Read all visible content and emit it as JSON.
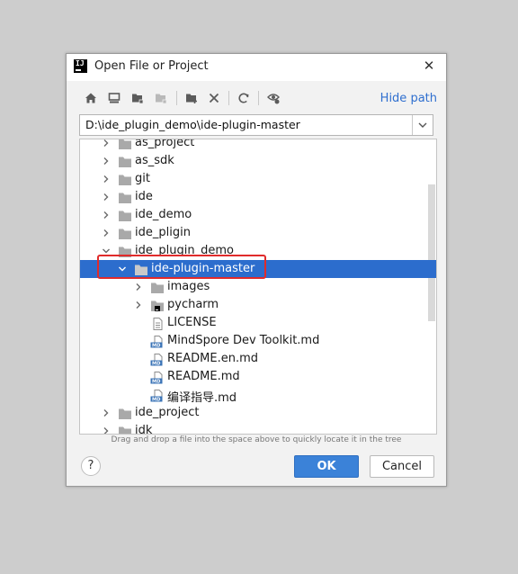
{
  "dialog": {
    "title": "Open File or Project",
    "hide_path_label": "Hide path",
    "path_value": "D:\\ide_plugin_demo\\ide-plugin-master",
    "hint": "Drag and drop a file into the space above to quickly locate it in the tree",
    "ok_label": "OK",
    "cancel_label": "Cancel",
    "help_label": "?"
  },
  "toolbar": {
    "buttons": [
      "home-icon",
      "desktop-icon",
      "project-folder-icon",
      "module-folder-icon",
      "new-folder-icon",
      "delete-icon",
      "refresh-icon",
      "show-hidden-icon"
    ]
  },
  "tree": {
    "rows": [
      {
        "label": "as_project",
        "level": 0,
        "expanded": false,
        "kind": "folder"
      },
      {
        "label": "as_sdk",
        "level": 0,
        "expanded": false,
        "kind": "folder"
      },
      {
        "label": "git",
        "level": 0,
        "expanded": false,
        "kind": "folder"
      },
      {
        "label": "ide",
        "level": 0,
        "expanded": false,
        "kind": "folder"
      },
      {
        "label": "ide_demo",
        "level": 0,
        "expanded": false,
        "kind": "folder"
      },
      {
        "label": "ide_pligin",
        "level": 0,
        "expanded": false,
        "kind": "folder"
      },
      {
        "label": "ide_plugin_demo",
        "level": 0,
        "expanded": true,
        "kind": "folder"
      },
      {
        "label": "ide-plugin-master",
        "level": 1,
        "expanded": true,
        "kind": "folder",
        "selected": true
      },
      {
        "label": "images",
        "level": 2,
        "expanded": false,
        "kind": "folder"
      },
      {
        "label": "pycharm",
        "level": 2,
        "expanded": false,
        "kind": "pycharm-folder"
      },
      {
        "label": "LICENSE",
        "level": 2,
        "kind": "file"
      },
      {
        "label": "MindSpore Dev Toolkit.md",
        "level": 2,
        "kind": "md"
      },
      {
        "label": "README.en.md",
        "level": 2,
        "kind": "md"
      },
      {
        "label": "README.md",
        "level": 2,
        "kind": "md"
      },
      {
        "label": "编译指导.md",
        "level": 2,
        "kind": "md"
      },
      {
        "label": "ide_project",
        "level": 0,
        "expanded": false,
        "kind": "folder"
      },
      {
        "label": "idk",
        "level": 0,
        "expanded": false,
        "kind": "folder"
      }
    ]
  },
  "colors": {
    "selection": "#2c6dcd",
    "link": "#2f6fcf",
    "ok_button": "#3b82d8",
    "highlight": "#e02b2b"
  }
}
